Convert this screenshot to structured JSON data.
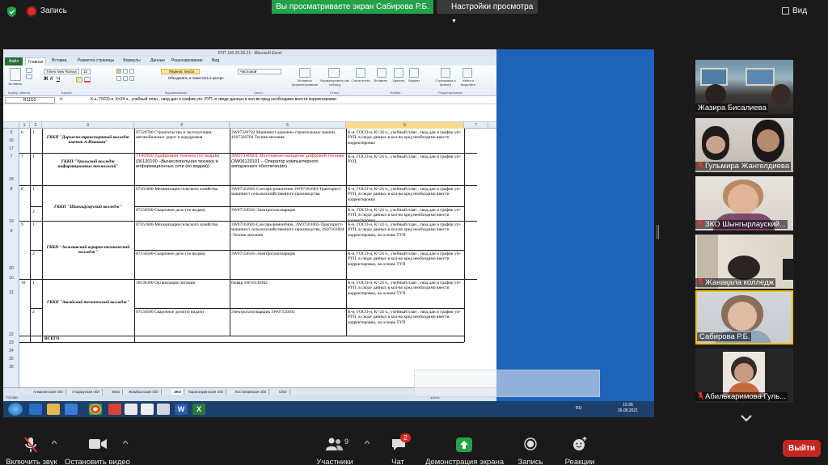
{
  "top": {
    "record_label": "Запись",
    "viewing_banner": "Вы просматриваете экран Сабирова Р.Б.",
    "view_settings": "Настройки просмотра",
    "view_button": "Вид"
  },
  "excel": {
    "title": "РУП 160 25.06.21 - Microsoft Excel",
    "tabs": [
      "Файл",
      "Главная",
      "Вставка",
      "Разметка страницы",
      "Формулы",
      "Данные",
      "Рецензирование",
      "Вид"
    ],
    "ribbon": {
      "paste": "Вставить",
      "font_name": "Times New Roman",
      "font_size": "12",
      "wrap_text": "Перенос текста",
      "merge": "Объединить и поместить в центре",
      "number_format": "Числовой",
      "cond_format": "Условное форматирование",
      "format_table": "Форматировать как таблицу",
      "cell_styles": "Стили ячеек",
      "insert": "Вставить",
      "delete": "Удалить",
      "format": "Формат",
      "sort": "Сортировка и фильтр",
      "find": "Найти и выделить",
      "groups": [
        "Буфер обмена",
        "Шрифт",
        "Выравнивание",
        "Число",
        "Стили",
        "Ячейки",
        "Редактирование"
      ]
    },
    "namebox": "R11C6",
    "formula": "К-н, ГОСО-н, К=24 ч., учебный план , свод.дан и график уп+ РУП, в своде данных в кол-во кред необходимо внести корректировки",
    "columns": [
      "1",
      "2",
      "3",
      "4",
      "5",
      "6",
      "7"
    ],
    "colleges": {
      "r6": "ГККП \"Дорожно-транспортный колледж имении А.Иманова\"",
      "r7": "ГККП \"Уральский колледж информационных технологий\"",
      "r8": "ГККП \"Шынгырлауский колледж\"",
      "r9": "ГККП \"Акжаикский аграрно-технический колледж\"",
      "r10": "ГККП \"Аксайский технический колледж\""
    },
    "numbers": {
      "r6": "6",
      "r7": "7",
      "r8": "8",
      "r9": "9",
      "r10": "10",
      "s1": "1",
      "s2": "2"
    },
    "specialties": {
      "r6": "07320700 Строительство и эксплуатация автомобильных дорог и аэродромов",
      "r7": "7140500 (Цифровая техника (по видам)",
      "r7b": "(06120100 –Вычислительная техника и информационные сети (по видам))",
      "r8a": "07161600-Механизация сельского хозяйства",
      "r8b": "07150500-Сварочное дело (по видам)",
      "r9a": "07161600-Механизация сельского хозяйства",
      "r9b": "07150500-Сварочное дело (по видам)",
      "r10a": "10130300 Организация питания",
      "r10b": "07150500 Сварочное дело(по видам)"
    },
    "qualifications": {
      "r6": "3W07320702 Машинист дорожно-строительных машин, 4S07320704 Техник-механик",
      "r7": "3W07140501 Монтажник-наладчик цифровой техники",
      "r7b": "(3W06120101 – Оператор компьютерного аппаратного обеспечения)",
      "r8a": "3W07161601-Слесарь-ремонтник 3W07161603-Тракторист-машинист сельскохозяйственного производства",
      "r8b": "3W07150501-Электрогазосварщик",
      "r9a": "3W07161601-Слесарь-ремонтник, 3W07161603-Тракторист-машинист сельскохозяйственного производства, 4S07161604 -Техник-механик",
      "r9b": "3W07150501-Электрогазосварщик",
      "r10a": "Повар 3W10130302",
      "r10b": "Электрогазосварщик 3W07150501"
    },
    "remarks": {
      "r6": "К-н, ГОСО-н, К=24 ч., учебный план , свод.дан и график уп+ РУП, в своде данных в кол-во кред необходимо внести корректировки",
      "r7": "К-н, ГОСО-н, К=24 ч., учебный план , свод.дан и график уп+ РУП,",
      "r8a": "К-н, ГОСО-н, К=24 ч., учебный план , свод.дан и график уп+ РУП, в своде данных в кол-во кред необходимо внести корректировки",
      "r8b": "К-н, ГОСО-н, К=24 ч., учебный план , свод.дан и график уп+ РУП, в своде данных в кол-во кред необходимо внести корректировки",
      "r9a": "К-н, ГОСО-н, К=24 ч., учебный план , свод.дан и график уп+ РУП, в своде данных в кол-во кред необходимо внести корректировки, на основе ТУП",
      "r9b": "К-н, ГОСО-н, К=24 ч., учебный план , свод.дан и график уп+ РУП, в своде данных в кол-во кред необходимо внести корректировки, на основе ТУП",
      "r10a": "К-н, ГОСО-н, К=24 ч., учебный план , свод.дан и график уп+ РУП, в своде данных в кол-во кред необходимо внести корректировки, на основе ТУП",
      "r10b": "К-н, ГОСО-н, К=24 ч., учебный план , свод.дан и график уп+ РУП, в своде данных в кол-во кред необходимо внести корректировки, на основе ТУП"
    },
    "total": "ВСЕГО",
    "row_labels": [
      "16",
      "17",
      "18",
      "19",
      "20",
      "21",
      "22",
      "23",
      "24",
      "25",
      "26"
    ],
    "sheet_tabs": [
      "Алматинская обл",
      "Атырауская обл",
      "ВКО",
      "Жамбылская обл",
      "ЗКО",
      "Карагандинская обл",
      "Костанайская обл",
      "СКО"
    ],
    "status_ready": "Готово",
    "zoom": "100%",
    "tray_time": "15:26",
    "tray_date": "26.08.2021",
    "tray_lang": "RU"
  },
  "participants": [
    {
      "name": "Жазира Бисалиева",
      "muted": false
    },
    {
      "name": "Гульмира Жангелдиева",
      "muted": true
    },
    {
      "name": "ЗКО Шынгырлауский...",
      "muted": true
    },
    {
      "name": "Жанақала колледж",
      "muted": true
    },
    {
      "name": "Сабирова Р.Б.",
      "muted": false
    },
    {
      "name": "Абилькаримова Гуль...",
      "muted": true
    }
  ],
  "toolbar": {
    "mute_label": "Включить звук",
    "video_label": "Остановить видео",
    "participants_label": "Участники",
    "participants_count": "9",
    "chat_label": "Чат",
    "chat_badge": "2",
    "share_label": "Демонстрация экрана",
    "record_label": "Запись",
    "reactions_label": "Реакции",
    "leave_label": "Выйти"
  },
  "colors": {
    "accent_green": "#23a14a",
    "leave_red": "#c3261f",
    "active_speaker": "#f5c400",
    "excel_green": "#2a6e37"
  }
}
